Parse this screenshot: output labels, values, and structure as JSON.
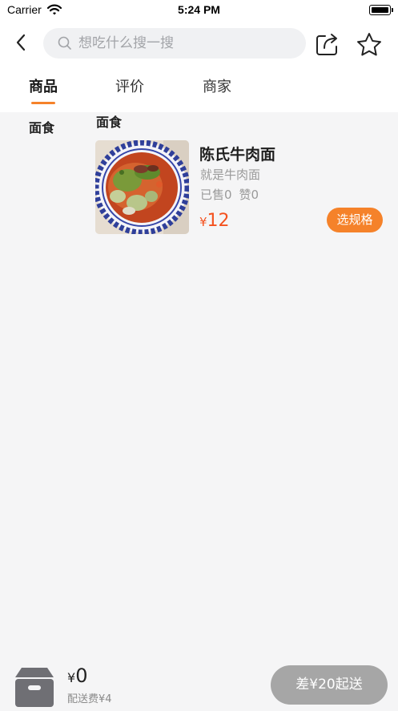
{
  "status_bar": {
    "carrier": "Carrier",
    "time": "5:24 PM",
    "wifi_icon": "wifi-icon",
    "battery_icon": "battery-icon"
  },
  "nav": {
    "back_icon": "chevron-left-icon",
    "search_icon": "search-icon",
    "search_placeholder": "想吃什么搜一搜",
    "search_value": "",
    "share_icon": "share-icon",
    "favorite_icon": "star-icon"
  },
  "tabs": [
    {
      "label": "商品",
      "active": true
    },
    {
      "label": "评价",
      "active": false
    },
    {
      "label": "商家",
      "active": false
    }
  ],
  "sidebar": {
    "items": [
      {
        "label": "面食",
        "selected": true
      }
    ]
  },
  "menu": {
    "section_title": "面食",
    "products": [
      {
        "name": "陈氏牛肉面",
        "description": "就是牛肉面",
        "sold": "已售0",
        "likes": "赞0",
        "currency": "¥",
        "price": "12",
        "spec_button": "选规格",
        "image_icon": "beef-noodle-bowl-image"
      }
    ]
  },
  "cart": {
    "icon": "cart-box-icon",
    "currency": "¥",
    "total": "0",
    "delivery_fee": "配送费¥4",
    "checkout_label": "差¥20起送"
  },
  "colors": {
    "accent": "#f5822a",
    "price": "#f4511e",
    "checkout_disabled": "#a6a6a6",
    "background": "#f5f5f6"
  }
}
